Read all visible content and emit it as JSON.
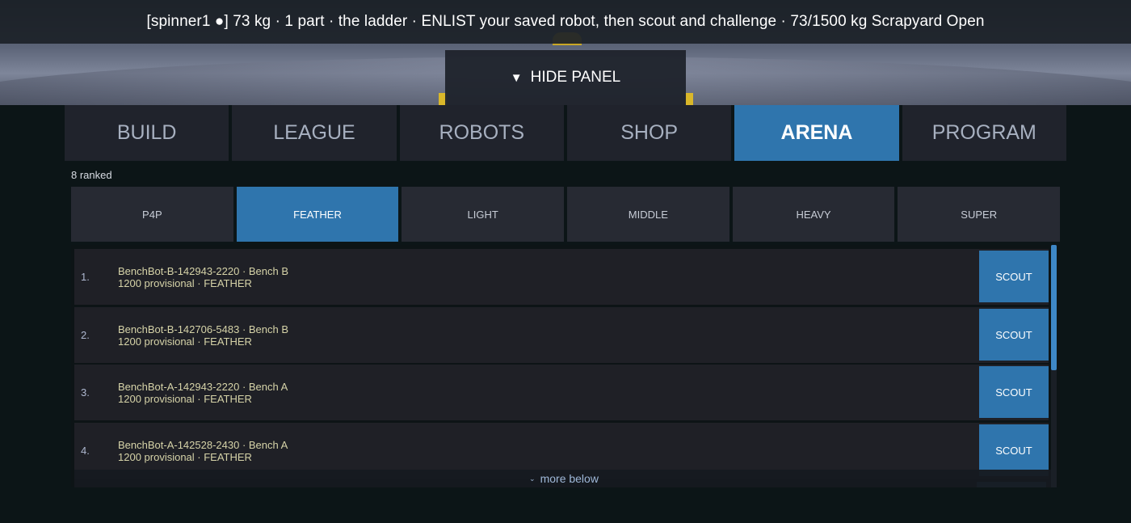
{
  "status_bar": {
    "text": "[spinner1 ●]  73 kg · 1 part  ·  the ladder · ENLIST your saved robot, then scout and challenge  ·  73/1500 kg Scrapyard Open"
  },
  "hide_panel": {
    "icon": "triangle-down-icon",
    "label": "HIDE PANEL"
  },
  "tabs": [
    {
      "label": "BUILD",
      "active": false
    },
    {
      "label": "LEAGUE",
      "active": false
    },
    {
      "label": "ROBOTS",
      "active": false
    },
    {
      "label": "SHOP",
      "active": false
    },
    {
      "label": "ARENA",
      "active": true
    },
    {
      "label": "PROGRAM",
      "active": false
    }
  ],
  "ranked_count": "8 ranked",
  "weight_classes": [
    {
      "label": "P4P",
      "active": false
    },
    {
      "label": "FEATHER",
      "active": true
    },
    {
      "label": "LIGHT",
      "active": false
    },
    {
      "label": "MIDDLE",
      "active": false
    },
    {
      "label": "HEAVY",
      "active": false
    },
    {
      "label": "SUPER",
      "active": false
    }
  ],
  "ladder": [
    {
      "rank": "1.",
      "line1": "BenchBot-B-142943-2220  ·  Bench B",
      "line2": "1200  provisional  ·  FEATHER",
      "action": "SCOUT"
    },
    {
      "rank": "2.",
      "line1": "BenchBot-B-142706-5483  ·  Bench B",
      "line2": "1200  provisional  ·  FEATHER",
      "action": "SCOUT"
    },
    {
      "rank": "3.",
      "line1": "BenchBot-A-142943-2220  ·  Bench A",
      "line2": "1200  provisional  ·  FEATHER",
      "action": "SCOUT"
    },
    {
      "rank": "4.",
      "line1": "BenchBot-A-142528-2430  ·  Bench A",
      "line2": "1200  provisional  ·  FEATHER",
      "action": "SCOUT"
    }
  ],
  "more_below": {
    "icon": "chevron-down-icon",
    "label": "more below"
  },
  "colors": {
    "accent": "#2f75ad",
    "tab_bg": "#20232c",
    "row_bg": "#1f2026",
    "page_bg": "#0c1517"
  }
}
